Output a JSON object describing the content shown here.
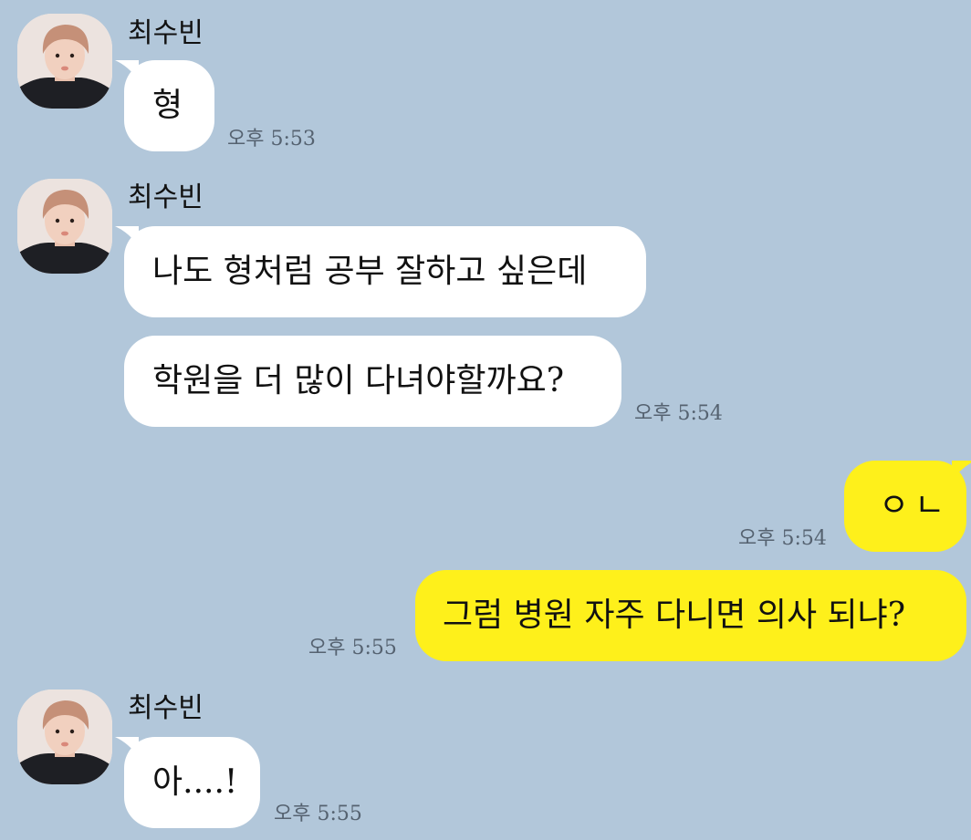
{
  "chat": {
    "sender_name": "최수빈",
    "messages": [
      {
        "text": "형",
        "time": "오후 5:53"
      },
      {
        "text": "나도 형처럼 공부 잘하고 싶은데"
      },
      {
        "text": "학원을 더 많이 다녀야할까요?",
        "time": "오후 5:54"
      },
      {
        "text": "ㅇㄴ",
        "time": "오후 5:54"
      },
      {
        "text": "그럼 병원 자주 다니면 의사 되냐?",
        "time": "오후 5:55"
      },
      {
        "text": "아....!",
        "time": "오후 5:55"
      }
    ]
  },
  "colors": {
    "background": "#b2c7da",
    "incoming_bubble": "#ffffff",
    "outgoing_bubble": "#fef01b",
    "timestamp": "#556270"
  },
  "icons": {
    "avatar": "profile-photo-avatar"
  }
}
